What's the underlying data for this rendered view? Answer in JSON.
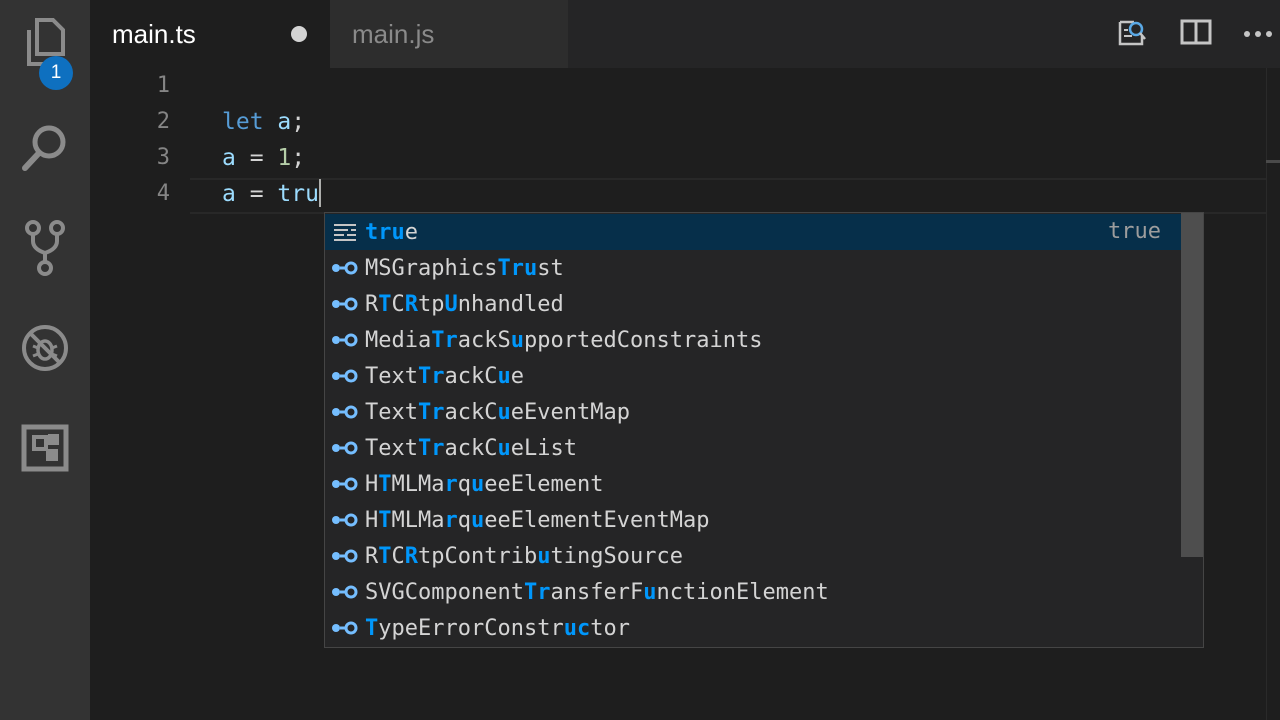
{
  "activity_bar": {
    "items": [
      {
        "name": "explorer-icon",
        "badge": "1"
      },
      {
        "name": "search-icon"
      },
      {
        "name": "source-control-icon"
      },
      {
        "name": "debug-icon"
      },
      {
        "name": "extensions-icon"
      }
    ]
  },
  "tabs": [
    {
      "label": "main.ts",
      "active": true,
      "dirty": true
    },
    {
      "label": "main.js",
      "active": false,
      "dirty": false
    }
  ],
  "tab_actions": [
    "open-preview-icon",
    "split-editor-icon",
    "more-actions-icon"
  ],
  "editor": {
    "line_numbers": [
      "1",
      "2",
      "3",
      "4"
    ],
    "lines": [
      [],
      [
        {
          "t": "let",
          "c": "kw"
        },
        {
          "t": " "
        },
        {
          "t": "a",
          "c": "id"
        },
        {
          "t": ";"
        }
      ],
      [
        {
          "t": "a",
          "c": "id"
        },
        {
          "t": " = "
        },
        {
          "t": "1",
          "c": "num"
        },
        {
          "t": ";"
        }
      ],
      [
        {
          "t": "a",
          "c": "id"
        },
        {
          "t": " = "
        },
        {
          "t": "tru",
          "c": "id"
        }
      ]
    ]
  },
  "suggest": {
    "items": [
      {
        "label": "true",
        "kind": "keyword",
        "detail": "true",
        "selected": true,
        "highlight": [
          0,
          1,
          2
        ]
      },
      {
        "label": "MSGraphicsTrust",
        "kind": "interface",
        "highlight": [
          10,
          11,
          12
        ]
      },
      {
        "label": "RTCRtpUnhandled",
        "kind": "interface",
        "highlight": [
          1,
          3,
          6
        ]
      },
      {
        "label": "MediaTrackSupportedConstraints",
        "kind": "interface",
        "highlight": [
          5,
          6,
          11
        ]
      },
      {
        "label": "TextTrackCue",
        "kind": "interface",
        "highlight": [
          4,
          5,
          10
        ]
      },
      {
        "label": "TextTrackCueEventMap",
        "kind": "interface",
        "highlight": [
          4,
          5,
          10
        ]
      },
      {
        "label": "TextTrackCueList",
        "kind": "interface",
        "highlight": [
          4,
          5,
          10
        ]
      },
      {
        "label": "HTMLMarqueeElement",
        "kind": "interface",
        "highlight": [
          1,
          6,
          8
        ]
      },
      {
        "label": "HTMLMarqueeElementEventMap",
        "kind": "interface",
        "highlight": [
          1,
          6,
          8
        ]
      },
      {
        "label": "RTCRtpContributingSource",
        "kind": "interface",
        "highlight": [
          1,
          3,
          13
        ]
      },
      {
        "label": "SVGComponentTransferFunctionElement",
        "kind": "interface",
        "highlight": [
          12,
          13,
          21
        ]
      },
      {
        "label": "TypeErrorConstructor",
        "kind": "interface",
        "highlight": [
          0,
          15,
          16
        ]
      }
    ]
  }
}
